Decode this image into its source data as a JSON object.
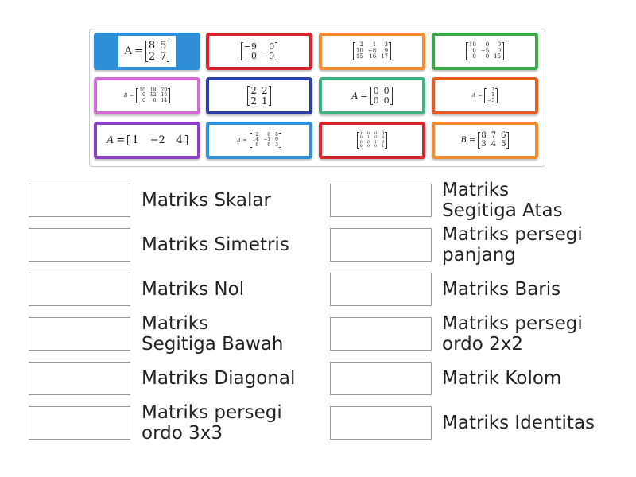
{
  "tiles": [
    {
      "color": "#2e8fd6",
      "selected": true,
      "prefix": "A",
      "prefix_style": "upright",
      "rows": [
        [
          "8",
          "5"
        ],
        [
          "2",
          "7"
        ]
      ]
    },
    {
      "color": "#d9232e",
      "prefix": "",
      "rows": [
        [
          "−9",
          "0"
        ],
        [
          "0",
          "−9"
        ]
      ]
    },
    {
      "color": "#f28a2e",
      "prefix": "",
      "rows": [
        [
          "2",
          "1",
          "3"
        ],
        [
          "10",
          "−8",
          "9"
        ],
        [
          "15",
          "16",
          "17"
        ]
      ]
    },
    {
      "color": "#3aa84a",
      "prefix": "",
      "rows": [
        [
          "10",
          "0",
          "0"
        ],
        [
          "0",
          "−5",
          "0"
        ],
        [
          "0",
          "0",
          "15"
        ]
      ]
    },
    {
      "color": "#d46ad6",
      "prefix": "B",
      "rows": [
        [
          "10",
          "18",
          "20"
        ],
        [
          "0",
          "12",
          "16"
        ],
        [
          "0",
          "0",
          "14"
        ]
      ]
    },
    {
      "color": "#2a3fa8",
      "prefix": "",
      "rows": [
        [
          "2",
          "2"
        ],
        [
          "2",
          "1"
        ]
      ]
    },
    {
      "color": "#3fb27f",
      "prefix": "A",
      "rows": [
        [
          "0",
          "0"
        ],
        [
          "0",
          "0"
        ]
      ]
    },
    {
      "color": "#e85a1f",
      "prefix": "A",
      "rows": [
        [
          "3"
        ],
        [
          "1"
        ],
        [
          "−5"
        ]
      ]
    },
    {
      "color": "#8a3fc6",
      "prefix": "A",
      "rows": [
        [
          "1",
          "−2",
          "4"
        ]
      ]
    },
    {
      "color": "#2f8fd8",
      "prefix": "B",
      "rows": [
        [
          "2",
          "0",
          "0"
        ],
        [
          "14",
          "−1",
          "0"
        ],
        [
          "8",
          "6",
          "3"
        ]
      ]
    },
    {
      "color": "#d9232e",
      "prefix": "",
      "rows": [
        [
          "1",
          "0",
          "0",
          "0"
        ],
        [
          "0",
          "1",
          "0",
          "0"
        ],
        [
          "0",
          "0",
          "1",
          "0"
        ],
        [
          "0",
          "0",
          "0",
          "1"
        ]
      ]
    },
    {
      "color": "#f28a2e",
      "prefix": "B",
      "rows": [
        [
          "8",
          "7",
          "6"
        ],
        [
          "3",
          "4",
          "5"
        ]
      ]
    }
  ],
  "targets_left": [
    {
      "label": "Matriks Skalar"
    },
    {
      "label": "Matriks Simetris"
    },
    {
      "label": "Matriks Nol"
    },
    {
      "label": "Matriks\nSegitiga Bawah"
    },
    {
      "label": "Matriks Diagonal"
    },
    {
      "label": "Matriks persegi\nordo 3x3"
    }
  ],
  "targets_right": [
    {
      "label": "Matriks\nSegitiga Atas"
    },
    {
      "label": "Matriks persegi\npanjang"
    },
    {
      "label": "Matriks Baris"
    },
    {
      "label": "Matriks persegi\nordo 2x2"
    },
    {
      "label": "Matrik Kolom"
    },
    {
      "label": "Matriks Identitas"
    }
  ]
}
